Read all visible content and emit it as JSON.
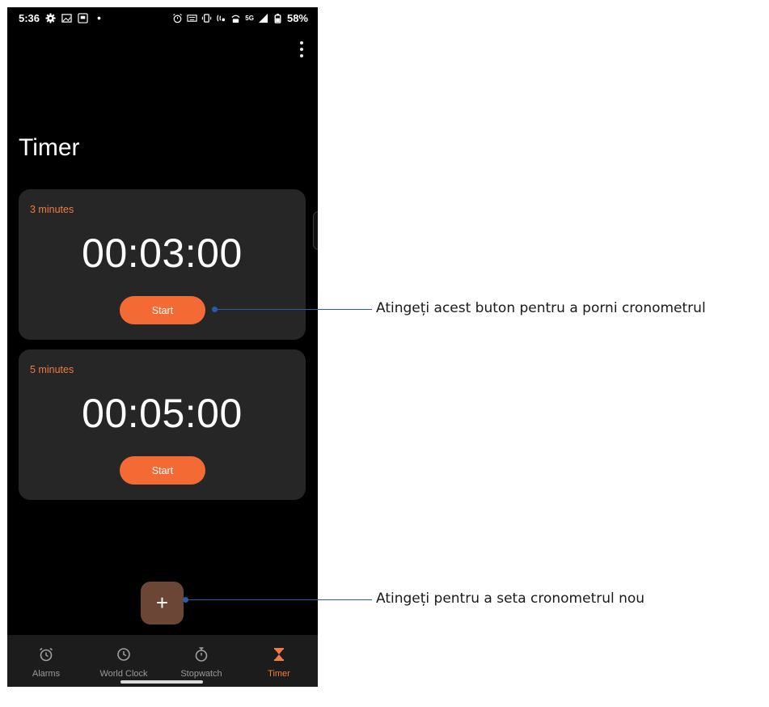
{
  "status_bar": {
    "time": "5:36",
    "network": "5G",
    "battery": "58%"
  },
  "page": {
    "title": "Timer"
  },
  "timers": [
    {
      "label": "3 minutes",
      "time": "00:03:00",
      "button": "Start"
    },
    {
      "label": "5 minutes",
      "time": "00:05:00",
      "button": "Start"
    }
  ],
  "fab": {
    "icon": "plus-icon",
    "symbol": "+"
  },
  "nav": {
    "items": [
      {
        "label": "Alarms",
        "icon": "alarm-icon"
      },
      {
        "label": "World Clock",
        "icon": "clock-icon"
      },
      {
        "label": "Stopwatch",
        "icon": "stopwatch-icon"
      },
      {
        "label": "Timer",
        "icon": "hourglass-icon"
      }
    ],
    "active": "Timer"
  },
  "callouts": {
    "start": "Atingeți acest buton pentru a porni cronometrul",
    "add": "Atingeți pentru a seta cronometrul nou"
  },
  "colors": {
    "accent": "#f36a35",
    "card": "#262626",
    "callout": "#2a5aa8"
  }
}
